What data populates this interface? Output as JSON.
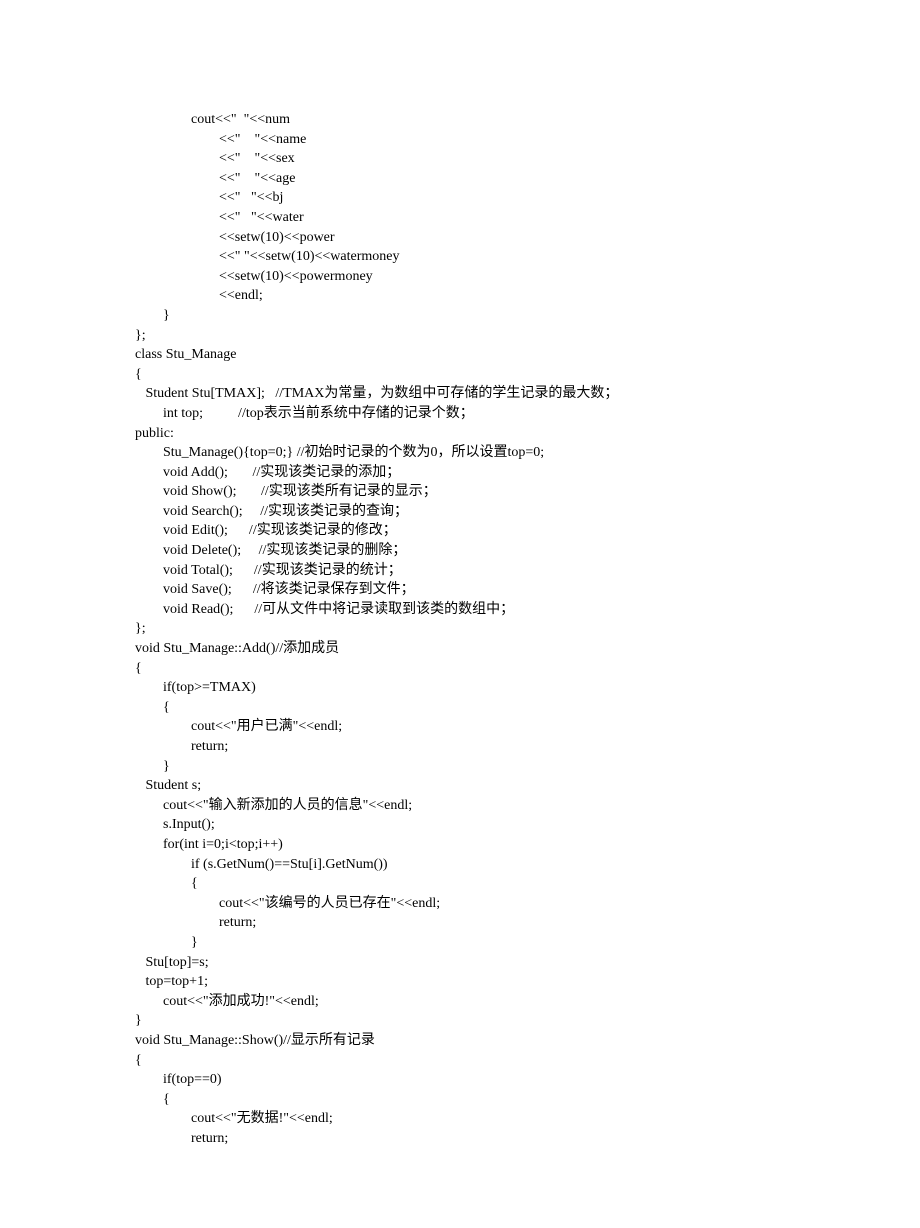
{
  "lines": [
    "                cout<<\"  \"<<num",
    "                        <<\"    \"<<name",
    "                        <<\"    \"<<sex",
    "                        <<\"    \"<<age",
    "                        <<\"   \"<<bj",
    "                        <<\"   \"<<water",
    "                        <<setw(10)<<power",
    "                        <<\" \"<<setw(10)<<watermoney",
    "                        <<setw(10)<<powermoney",
    "                        <<endl;",
    "        }",
    "};",
    "",
    "class Stu_Manage",
    "{",
    "   Student Stu[TMAX];   //TMAX为常量，为数组中可存储的学生记录的最大数；",
    "        int top;          //top表示当前系统中存储的记录个数；",
    "public:",
    "        Stu_Manage(){top=0;} //初始时记录的个数为0，所以设置top=0;",
    "        void Add();       //实现该类记录的添加；",
    "        void Show();       //实现该类所有记录的显示；",
    "        void Search();     //实现该类记录的查询；",
    "        void Edit();      //实现该类记录的修改；",
    "        void Delete();     //实现该类记录的删除；",
    "        void Total();      //实现该类记录的统计；",
    "        void Save();      //将该类记录保存到文件；",
    "        void Read();      //可从文件中将记录读取到该类的数组中；",
    "};",
    "void Stu_Manage::Add()//添加成员",
    "{",
    "        if(top>=TMAX)",
    "        {",
    "                cout<<\"用户已满\"<<endl;",
    "                return;",
    "        }",
    "   Student s;",
    "        cout<<\"输入新添加的人员的信息\"<<endl;",
    "        s.Input();",
    "        for(int i=0;i<top;i++)",
    "                if (s.GetNum()==Stu[i].GetNum())",
    "                {",
    "                        cout<<\"该编号的人员已存在\"<<endl;",
    "                        return;",
    "                }",
    "   Stu[top]=s;",
    "   top=top+1;",
    "        cout<<\"添加成功!\"<<endl;",
    "}",
    "void Stu_Manage::Show()//显示所有记录",
    "{",
    "        if(top==0)",
    "        {",
    "                cout<<\"无数据!\"<<endl;",
    "                return;"
  ]
}
